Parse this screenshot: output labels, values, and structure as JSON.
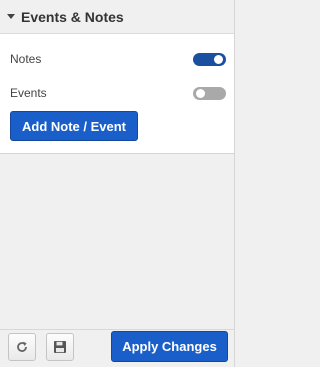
{
  "section": {
    "title": "Events & Notes",
    "collapse_icon": "caret-down-icon"
  },
  "rows": [
    {
      "label": "Notes",
      "toggle_on": true
    },
    {
      "label": "Events",
      "toggle_on": false
    }
  ],
  "add_button_label": "Add Note / Event",
  "footer": {
    "reset_icon": "refresh-icon",
    "save_icon": "floppy-disk-icon",
    "apply_label": "Apply Changes"
  },
  "colors": {
    "accent": "#1a5fc9",
    "toggle_on": "#1b4fa0",
    "toggle_off": "#a9a9a9"
  }
}
